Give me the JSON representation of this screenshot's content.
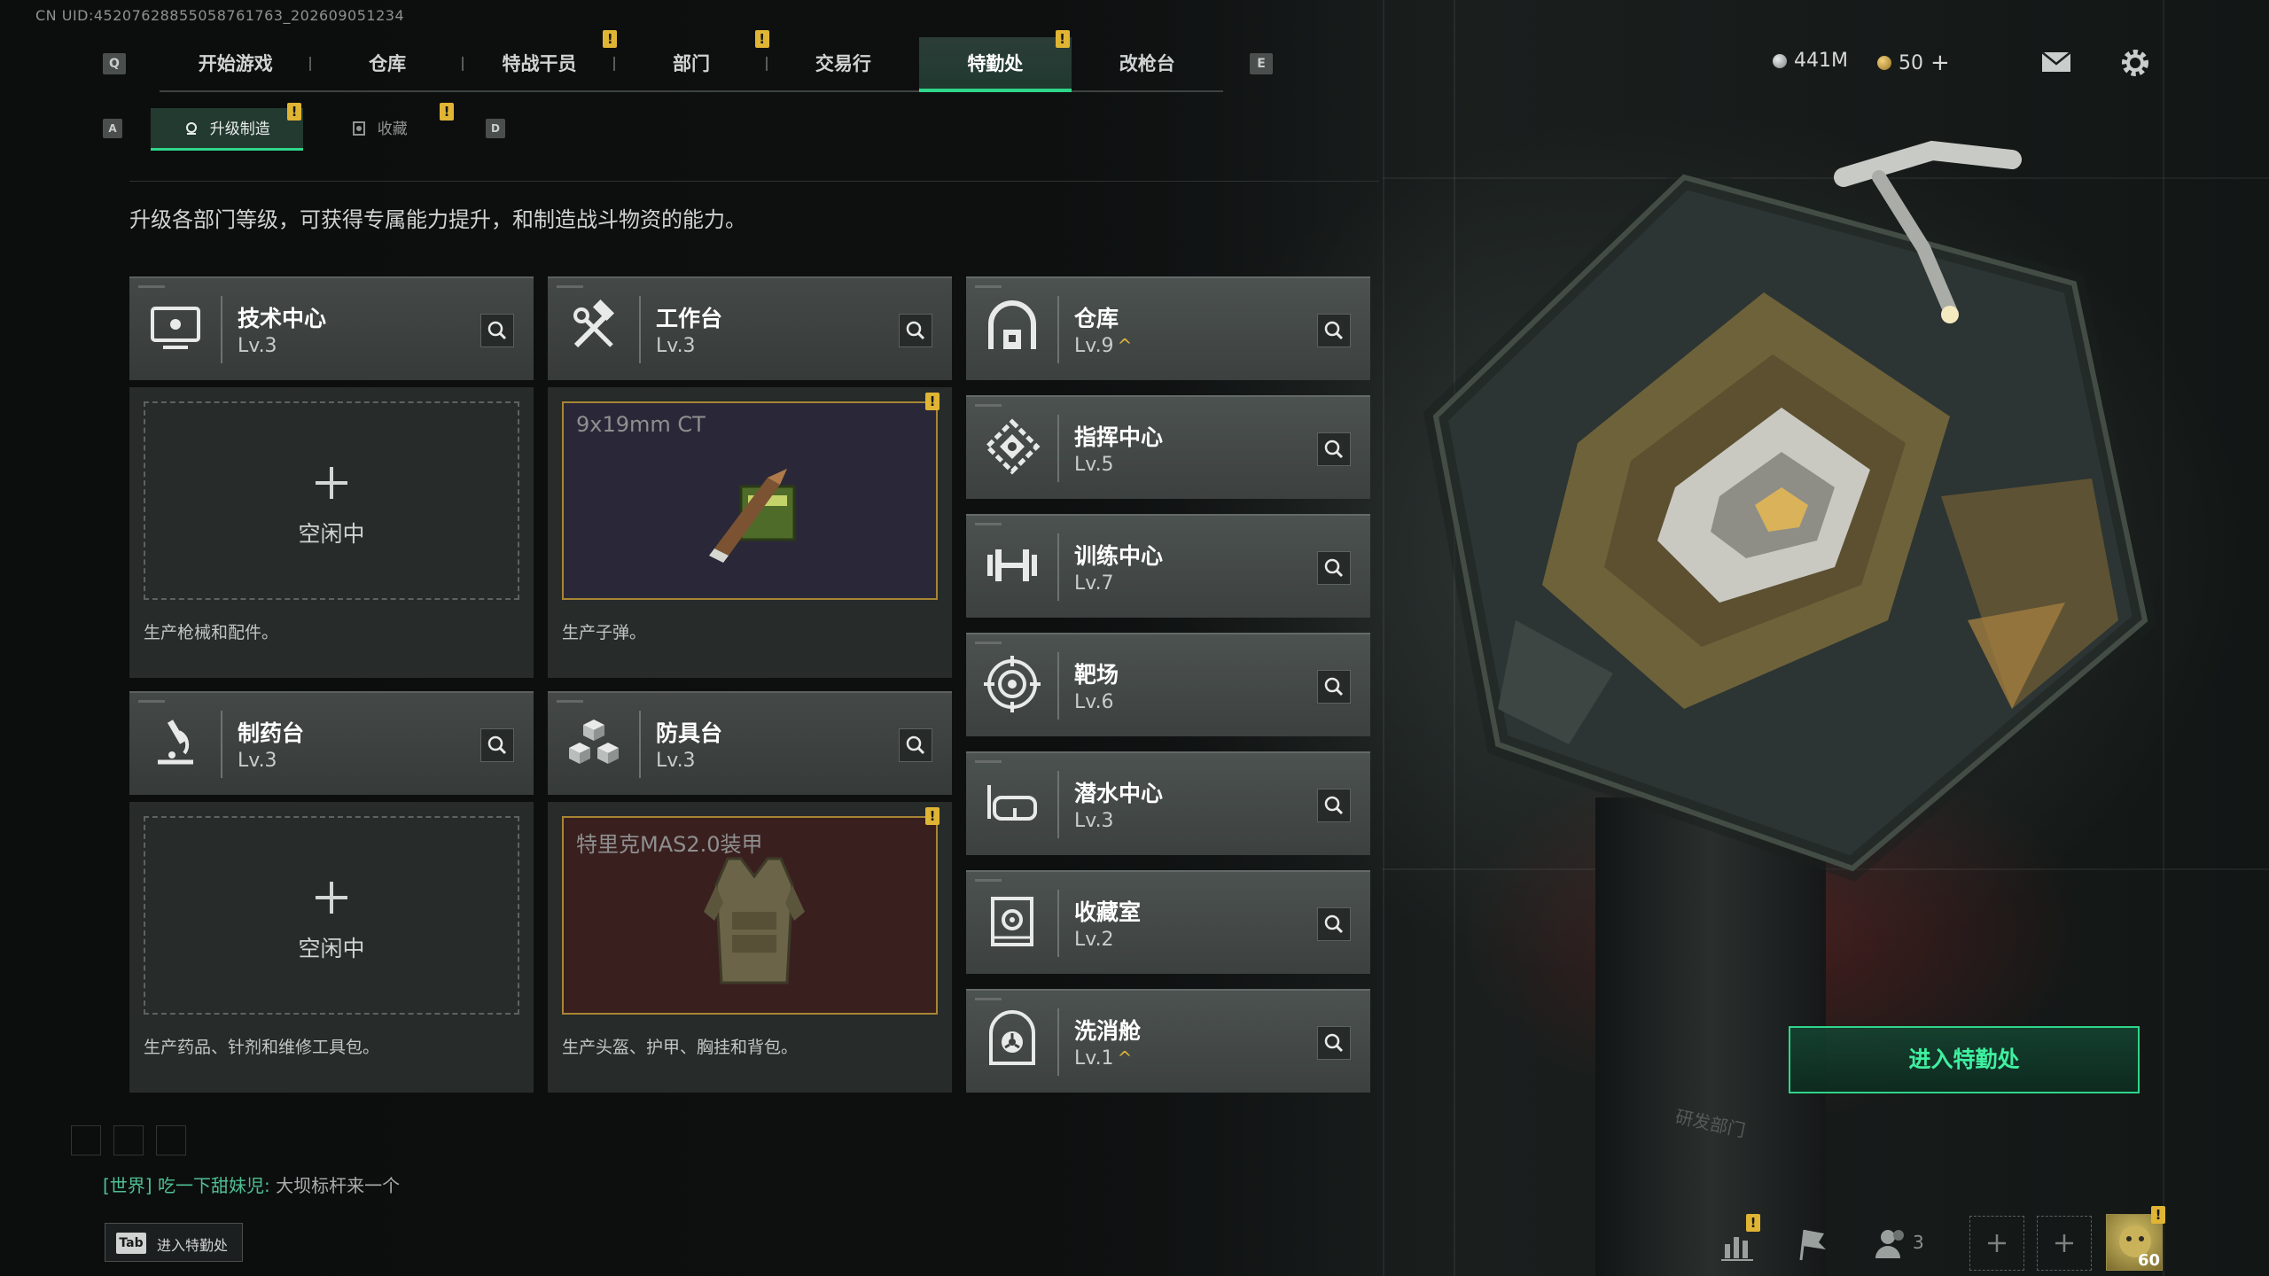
{
  "uid_text": "CN UID:4520762885505876176​3_202609051234",
  "key_hints": {
    "prev_tab": "Q",
    "next_tab": "E",
    "prev_sub": "A",
    "next_sub": "D"
  },
  "top_tabs": [
    {
      "label": "开始游戏",
      "badge": ""
    },
    {
      "label": "仓库",
      "badge": ""
    },
    {
      "label": "特战干员",
      "badge": "!"
    },
    {
      "label": "部门",
      "badge": "!"
    },
    {
      "label": "交易行",
      "badge": ""
    },
    {
      "label": "特勤处",
      "badge": "!",
      "active": true
    },
    {
      "label": "改枪台",
      "badge": ""
    }
  ],
  "resources": {
    "currency": "441M",
    "coins": "50",
    "coins_add": "+"
  },
  "sub_tabs": [
    {
      "label": "升级制造",
      "badge": "!",
      "active": true
    },
    {
      "label": "收藏",
      "badge": "!"
    }
  ],
  "description": "升级各部门等级，可获得专属能力提升，和制造战斗物资的能力。",
  "production": [
    {
      "name": "技术中心",
      "level": "Lv.3",
      "icon": "monitor-icon",
      "slot_state": "空闲中",
      "caption": "生产枪械和配件。"
    },
    {
      "name": "工作台",
      "level": "Lv.3",
      "icon": "hammer-wrench-icon",
      "slot_item": "9x19mm CT",
      "slot_badge": "!",
      "caption": "生产子弹。",
      "slot_bg": "#2a2838"
    },
    {
      "name": "制药台",
      "level": "Lv.3",
      "icon": "microscope-icon",
      "slot_state": "空闲中",
      "caption": "生产药品、针剂和维修工具包。"
    },
    {
      "name": "防具台",
      "level": "Lv.3",
      "icon": "cubes-icon",
      "slot_item": "特里克MAS2.0装甲",
      "slot_badge": "!",
      "caption": "生产头盔、护甲、胸挂和背包。",
      "slot_bg": "#3a1f1f"
    }
  ],
  "departments": [
    {
      "name": "仓库",
      "level": "Lv.9",
      "upgradable": true,
      "icon": "warehouse-icon"
    },
    {
      "name": "指挥中心",
      "level": "Lv.5",
      "upgradable": false,
      "icon": "command-icon"
    },
    {
      "name": "训练中心",
      "level": "Lv.7",
      "upgradable": false,
      "icon": "dumbbell-icon"
    },
    {
      "name": "靶场",
      "level": "Lv.6",
      "upgradable": false,
      "icon": "target-icon"
    },
    {
      "name": "潜水中心",
      "level": "Lv.3",
      "upgradable": false,
      "icon": "diving-mask-icon"
    },
    {
      "name": "收藏室",
      "level": "Lv.2",
      "upgradable": false,
      "icon": "vault-icon"
    },
    {
      "name": "洗消舱",
      "level": "Lv.1",
      "upgradable": true,
      "icon": "hazard-icon"
    }
  ],
  "upgrade_glyph": "^",
  "enter_button": "进入特勤处",
  "chat": {
    "channel": "[世界]",
    "sender": "吃一下甜妹児:",
    "message": "大坝标杆来一个"
  },
  "tab_hint": {
    "key": "Tab",
    "label": "进入特勤处"
  },
  "bottom_bar": {
    "friends_count": "3",
    "avatar_level": "60",
    "avatar_badge": "!",
    "stats_badge": "!"
  },
  "scene_caption": "研发部门",
  "colors": {
    "accent": "#2fd58a",
    "badge": "#e0b534",
    "card": "#404544"
  }
}
